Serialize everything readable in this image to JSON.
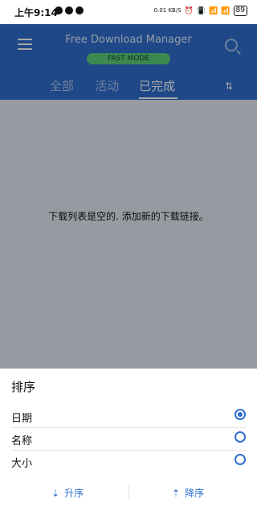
{
  "status_bar": {
    "time": "上午9:14",
    "speed": "0.01\nKB/S",
    "battery": "89"
  },
  "header": {
    "title": "Free Download Manager",
    "badge": "FAST MODE",
    "tabs": [
      {
        "label": "全部"
      },
      {
        "label": "活动"
      },
      {
        "label": "已完成"
      }
    ]
  },
  "content": {
    "empty_message": "下载列表是空的. 添加新的下载链接。"
  },
  "sheet": {
    "title": "排序",
    "options": [
      {
        "label": "日期",
        "selected": true
      },
      {
        "label": "名称",
        "selected": false
      },
      {
        "label": "大小",
        "selected": false
      }
    ],
    "buttons": {
      "ascending": "升序",
      "descending": "降序"
    }
  },
  "colors": {
    "header_bg": "#2f6fd1",
    "accent": "#2f6fd1",
    "fast_badge": "#5fd27b"
  },
  "icons": {
    "hamburger": "hamburger-icon",
    "search": "search-icon",
    "sort": "sort-icon",
    "radio_checked": "radio-checked-icon",
    "radio_unchecked": "radio-unchecked-icon",
    "asc": "sort-ascending-icon",
    "desc": "sort-descending-icon"
  }
}
